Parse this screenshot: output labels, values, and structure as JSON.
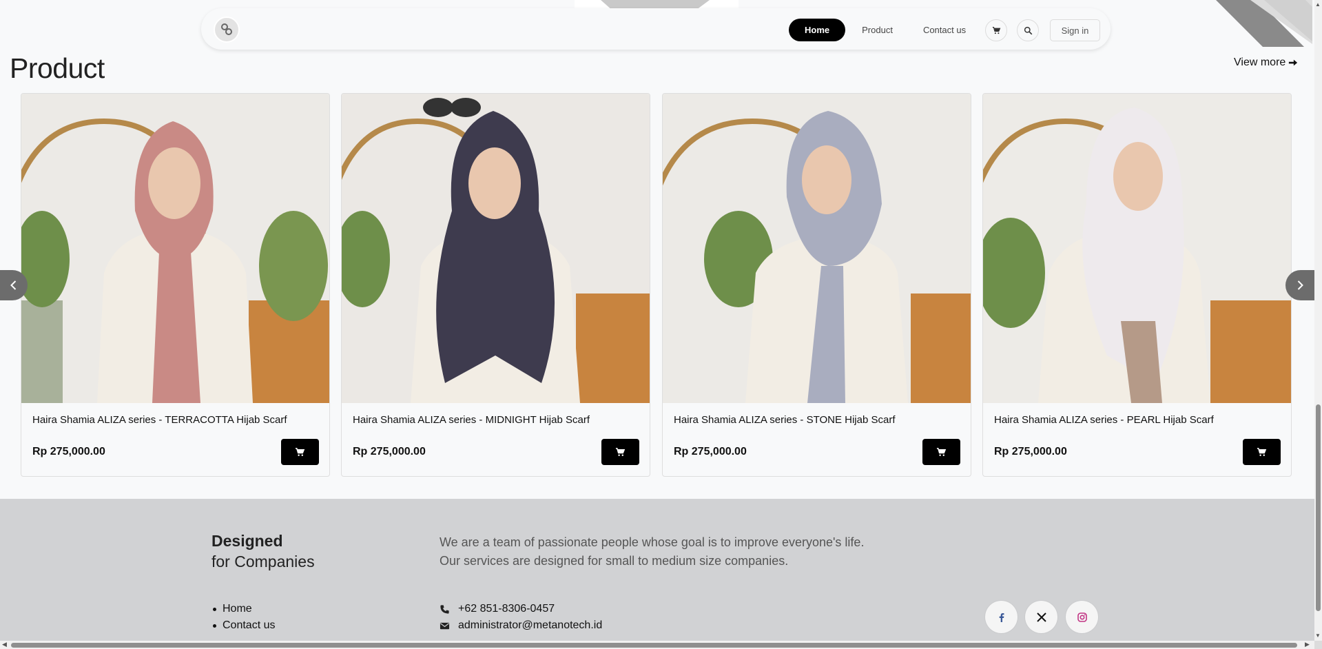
{
  "navbar": {
    "logo_icon": "brand-logo-icon",
    "links": [
      {
        "label": "Home",
        "active": true
      },
      {
        "label": "Product",
        "active": false
      },
      {
        "label": "Contact us",
        "active": false
      }
    ],
    "cart_icon": "cart-icon",
    "search_icon": "search-icon",
    "signin_label": "Sign in"
  },
  "section": {
    "title": "Product",
    "view_more_label": "View more",
    "view_more_icon": "arrow-right-icon"
  },
  "products": [
    {
      "name": "Haira Shamia ALIZA series - TERRACOTTA Hijab Scarf",
      "price": "Rp 275,000.00",
      "scarf_color": "#c98a85"
    },
    {
      "name": "Haira Shamia ALIZA series - MIDNIGHT Hijab Scarf",
      "price": "Rp 275,000.00",
      "scarf_color": "#3e3b4e"
    },
    {
      "name": "Haira Shamia ALIZA series - STONE Hijab Scarf",
      "price": "Rp 275,000.00",
      "scarf_color": "#a9adbf"
    },
    {
      "name": "Haira Shamia ALIZA series - PEARL Hijab Scarf",
      "price": "Rp 275,000.00",
      "scarf_color": "#eeeaed"
    }
  ],
  "carousel": {
    "prev_icon": "chevron-left-icon",
    "next_icon": "chevron-right-icon"
  },
  "footer": {
    "brand_line1": "Designed",
    "brand_line2": "for Companies",
    "description_line1": "We are a team of passionate people whose goal is to improve everyone's life.",
    "description_line2": "Our services are designed for small to medium size companies.",
    "links": [
      "Home",
      "Contact us"
    ],
    "phone": "+62 851-8306-0457",
    "email": "administrator@metanotech.id",
    "social": [
      {
        "name": "facebook-icon",
        "color": "#3b5998"
      },
      {
        "name": "x-twitter-icon",
        "color": "#111111"
      },
      {
        "name": "instagram-icon",
        "color": "#c13584"
      }
    ]
  },
  "colors": {
    "primary": "#000000",
    "background": "#f8f9fa",
    "footer_bg": "#d1d2d4",
    "arrow_bg": "#6c6c6c"
  }
}
